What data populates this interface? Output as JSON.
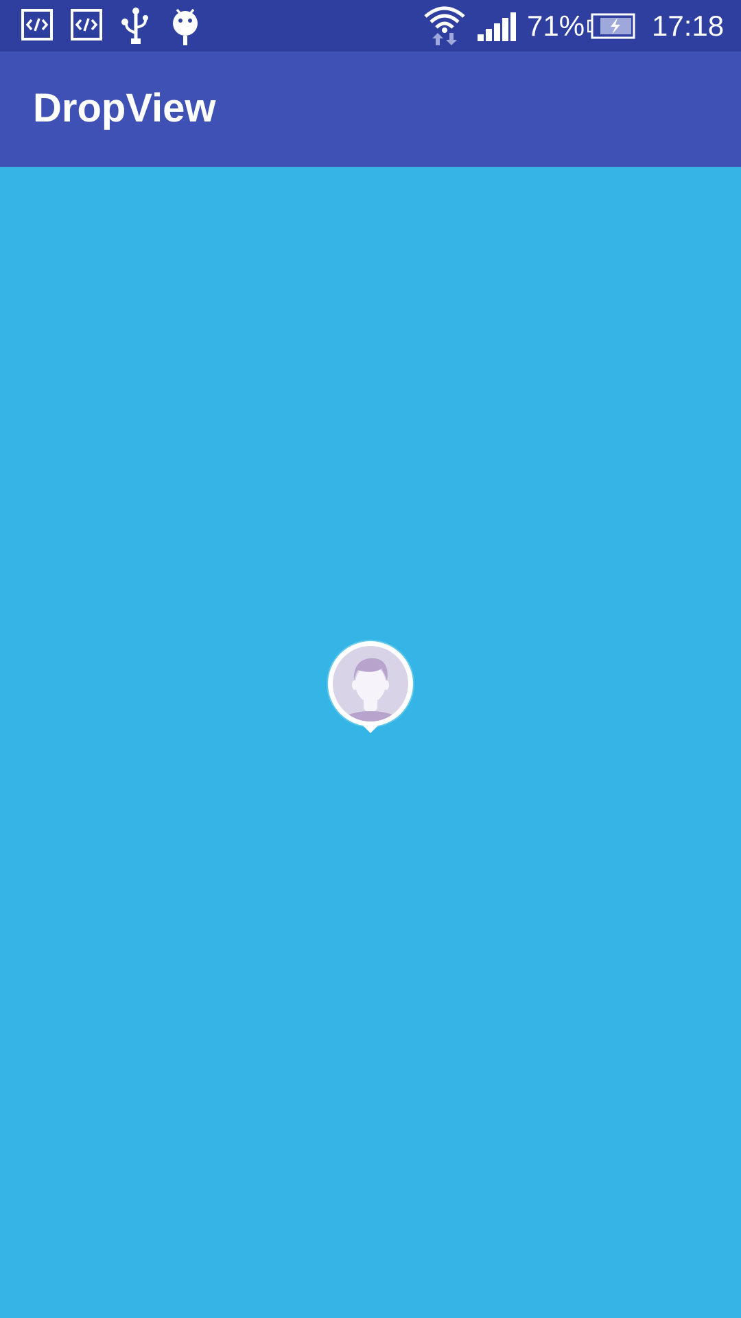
{
  "status_bar": {
    "icons": [
      "code-icon",
      "code-icon",
      "usb-icon",
      "android-debug-icon",
      "wifi-icon",
      "signal-icon",
      "battery-charging-icon"
    ],
    "battery_percent": "71%",
    "time": "17:18"
  },
  "app_bar": {
    "title": "DropView"
  },
  "drop_view": {
    "icon": "avatar-pin-icon"
  },
  "colors": {
    "status_bar": "#2f3f9f",
    "app_bar": "#3f51b5",
    "background": "#35b5e5",
    "avatar_fill": "#d9d3e7",
    "avatar_accent": "#b7a3cb"
  }
}
